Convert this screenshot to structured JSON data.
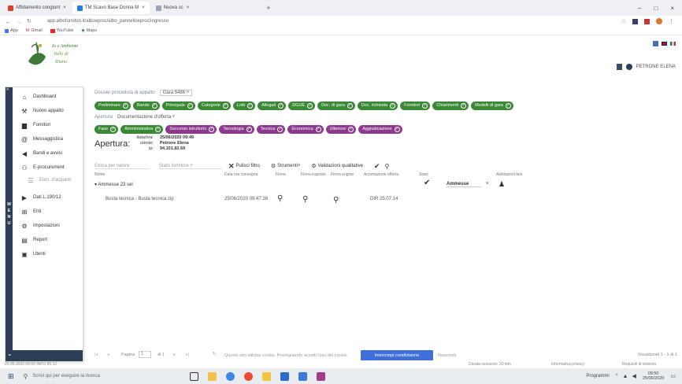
{
  "browser": {
    "tabs": [
      {
        "label": "Affidamento congiunt",
        "active": false,
        "color": "#d9412b"
      },
      {
        "label": "TM Scavo Base Donna M",
        "active": true,
        "color": "#2b7bd9"
      },
      {
        "label": "Nuova sc",
        "active": false,
        "color": "#9aa6b8"
      }
    ],
    "url": "app.albofornitori.it/alboeproc/albo_pannelloeproc/ingresso",
    "bookmarks": [
      "App",
      "Gmail",
      "YouTube",
      "Maps"
    ],
    "window_controls": [
      "–",
      "□",
      "×"
    ]
  },
  "logo": {
    "text": "Io e Ambiente Vallo di Diano"
  },
  "header": {
    "user_name": "PETRONE ELENA"
  },
  "sidebar": {
    "items": [
      {
        "label": "Dashboard",
        "icon": "home-icon"
      },
      {
        "label": "Nuovo appalto",
        "icon": "gavel-icon"
      },
      {
        "label": "Fornitori",
        "icon": "truck-icon"
      },
      {
        "label": "Messaggistica",
        "icon": "at-icon"
      },
      {
        "label": "Bandi e avvisi",
        "icon": "megaphone-icon"
      },
      {
        "label": "E-procurement",
        "icon": "people-icon"
      },
      {
        "label": "Elen. d'acquisti",
        "icon": "list-icon"
      },
      {
        "label": "Dati L.190/12",
        "icon": "share-icon"
      },
      {
        "label": "Enti",
        "icon": "sitemap-icon"
      },
      {
        "label": "Impostazioni",
        "icon": "gear-icon"
      },
      {
        "label": "Report",
        "icon": "chart-icon"
      },
      {
        "label": "Utenti",
        "icon": "user-icon"
      }
    ],
    "menu_letters": [
      "M",
      "E",
      "N",
      "U"
    ]
  },
  "main": {
    "crumb1": "Dossier procedura di appalto",
    "crumb1_sel": "Gara 5486",
    "steps": [
      "Preliminare",
      "Bando",
      "Principale",
      "Categorie",
      "Lotti",
      "Allegati",
      "DGUE",
      "Doc. di gara",
      "Doc. richiesta",
      "Fornitori",
      "Chiarimenti",
      "Modelli di gara"
    ],
    "crumb2": "Apertura",
    "crumb2_sel": "Documentazione d'offerta",
    "substeps": [
      "Fase",
      "Amministrativa",
      "Soccorso istruttorio",
      "Tecnologia",
      "Tecnica",
      "Economica",
      "Ulteriore",
      "Aggiudicazione"
    ],
    "apertura_label": "Apertura:",
    "apertura_info": {
      "k1": "data/ora:",
      "v1": "25/06/2020 09:49",
      "k2": "utente:",
      "v2": "Petrone Elena",
      "k3": "ip:",
      "v3": "94.101.82.69"
    },
    "filters": {
      "search_placeholder": "Cerca per valore",
      "select_placeholder": "Stato fornitore",
      "pulisci": "Pulisci filtro",
      "strumenti": "Strumenti",
      "validazioni": "Validazioni qualitative"
    },
    "columns": {
      "nome": "Nome",
      "data": "Data ora consegna",
      "firma": "Firma",
      "firma_esp": "Firma esposto",
      "firma_orig": "Firma origine",
      "accettazione": "Accettazione offerta",
      "stato": "Stato",
      "abilitazioni": "Abilitazioni fasi"
    },
    "group": "Ammesse 23 sel",
    "status_value": "Ammesse",
    "row": {
      "nome": "Busta tecnica - Busta tecnica.zip",
      "data": "25/06/2020 09:47:38",
      "data2": "DIR 25.07.14"
    }
  },
  "pager": {
    "pagina_label": "Pagina",
    "page": "1",
    "of_label": "di 1",
    "visualizzati": "Visualizzati 1 - 1 di 1"
  },
  "cookie": {
    "text": "Questo sito utilizza cookie. Proseguendo accetti l'uso dei cookie",
    "accept_button": "Interrompi condivisione",
    "nascondi": "Nascondi"
  },
  "statusbar": {
    "left": "25.06.2020 09:50 INFO 85.12",
    "sessione": "Durata sessione: 30 min",
    "privacy": "Informativa privacy",
    "requisiti": "Requisiti di sistema"
  },
  "taskbar": {
    "search_placeholder": "Scrivi qui per eseguire la ricerca",
    "programmi": "Programmi",
    "time": "09:50",
    "date": "25/06/2020"
  }
}
